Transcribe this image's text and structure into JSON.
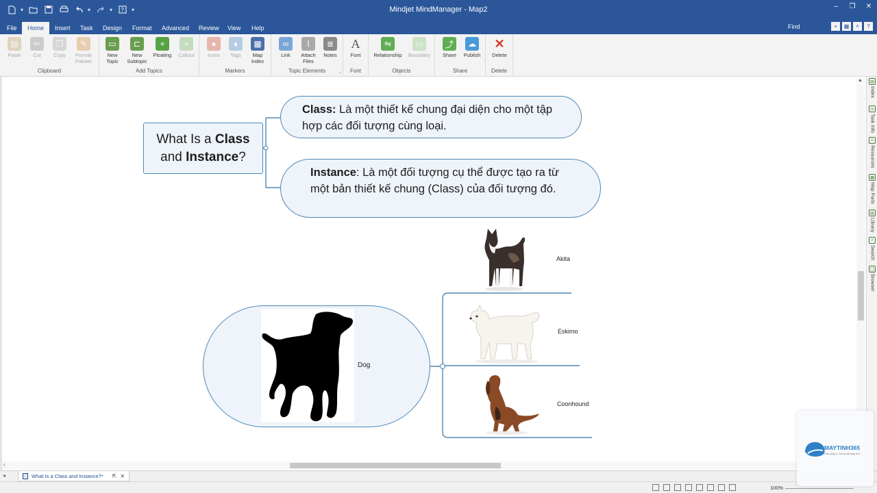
{
  "window": {
    "title": "Mindjet MindManager - Map2",
    "controls": [
      "minimize",
      "restore",
      "close"
    ]
  },
  "qat": [
    "new-file",
    "open",
    "save",
    "print",
    "undo",
    "redo",
    "help"
  ],
  "tabs": [
    {
      "label": "File"
    },
    {
      "label": "Home",
      "active": true
    },
    {
      "label": "Insert"
    },
    {
      "label": "Task"
    },
    {
      "label": "Design"
    },
    {
      "label": "Format"
    },
    {
      "label": "Advanced"
    },
    {
      "label": "Review"
    },
    {
      "label": "View"
    },
    {
      "label": "Help"
    }
  ],
  "find_label": "Find",
  "ribbon": {
    "groups": [
      {
        "label": "Clipboard",
        "buttons": [
          {
            "label": "Paste",
            "icon": "paste-icon",
            "disabled": true
          },
          {
            "label": "Cut",
            "icon": "cut-icon",
            "disabled": true
          },
          {
            "label": "Copy",
            "icon": "copy-icon",
            "disabled": true
          },
          {
            "label": "Format\nPainter",
            "icon": "format-painter-icon",
            "disabled": true
          }
        ]
      },
      {
        "label": "Add Topics",
        "buttons": [
          {
            "label": "New\nTopic",
            "icon": "new-topic-icon",
            "disabled": false
          },
          {
            "label": "New\nSubtopic",
            "icon": "new-subtopic-icon",
            "disabled": false
          },
          {
            "label": "Floating",
            "icon": "floating-icon",
            "disabled": false
          },
          {
            "label": "Callout",
            "icon": "callout-icon",
            "disabled": true
          }
        ]
      },
      {
        "label": "Markers",
        "buttons": [
          {
            "label": "Icons",
            "icon": "icons-icon",
            "disabled": true
          },
          {
            "label": "Tags",
            "icon": "tags-icon",
            "disabled": true
          },
          {
            "label": "Map\nIndex",
            "icon": "map-index-icon",
            "disabled": false
          }
        ]
      },
      {
        "label": "Topic Elements",
        "buttons": [
          {
            "label": "Link",
            "icon": "link-icon",
            "disabled": false
          },
          {
            "label": "Attach\nFiles",
            "icon": "attach-icon",
            "disabled": false
          },
          {
            "label": "Notes",
            "icon": "notes-icon",
            "disabled": false
          }
        ]
      },
      {
        "label": "Font",
        "buttons": [
          {
            "label": "Font",
            "icon": "font-icon",
            "disabled": false
          }
        ]
      },
      {
        "label": "Objects",
        "buttons": [
          {
            "label": "Relationship",
            "icon": "relationship-icon",
            "disabled": false
          },
          {
            "label": "Boundary",
            "icon": "boundary-icon",
            "disabled": true
          }
        ]
      },
      {
        "label": "Share",
        "buttons": [
          {
            "label": "Share",
            "icon": "share-icon",
            "disabled": false
          },
          {
            "label": "Publish",
            "icon": "publish-icon",
            "disabled": false
          }
        ]
      },
      {
        "label": "Delete",
        "buttons": [
          {
            "label": "Delete",
            "icon": "delete-icon",
            "disabled": false
          }
        ]
      }
    ]
  },
  "map": {
    "central_topic": {
      "prefix": "What Is a ",
      "bold1": "Class",
      "mid": "and ",
      "bold2": "Instance",
      "suffix": "?"
    },
    "class_topic": {
      "bold": "Class:",
      "text": " Là một thiết kế chung đại diện cho một tập hợp các đối tượng cùng loại."
    },
    "instance_topic": {
      "bold": "Instance",
      "text": ": Là một đối tượng cụ thể được tạo ra từ một bản thiết kế chung (Class) của đối tượng đó."
    },
    "dog_topic": {
      "label": "Dog",
      "image": "dog-silhouette"
    },
    "breeds": [
      {
        "label": "Akita",
        "image": "akita-photo"
      },
      {
        "label": "Eskimo",
        "image": "eskimo-photo"
      },
      {
        "label": "Coonhound",
        "image": "coonhound-photo"
      }
    ],
    "colors": {
      "topic_border": "#4d86b7",
      "topic_fill": "#eef4fa",
      "connector": "#4d86b7"
    }
  },
  "side_panel": [
    "Index",
    "Task Info",
    "Resources",
    "Map Parts",
    "Library",
    "Search",
    "Browser"
  ],
  "document_tab": {
    "label": "What Is a Class and Instance?*"
  },
  "status": {
    "zoom": "100%"
  },
  "watermark": {
    "brand": "MAYTINH365",
    "tagline": "Giải pháp & Thủ thuật Máy tính"
  },
  "theme": {
    "titlebar": "#2b579a",
    "ribbon_bg": "#f3f3f3"
  }
}
